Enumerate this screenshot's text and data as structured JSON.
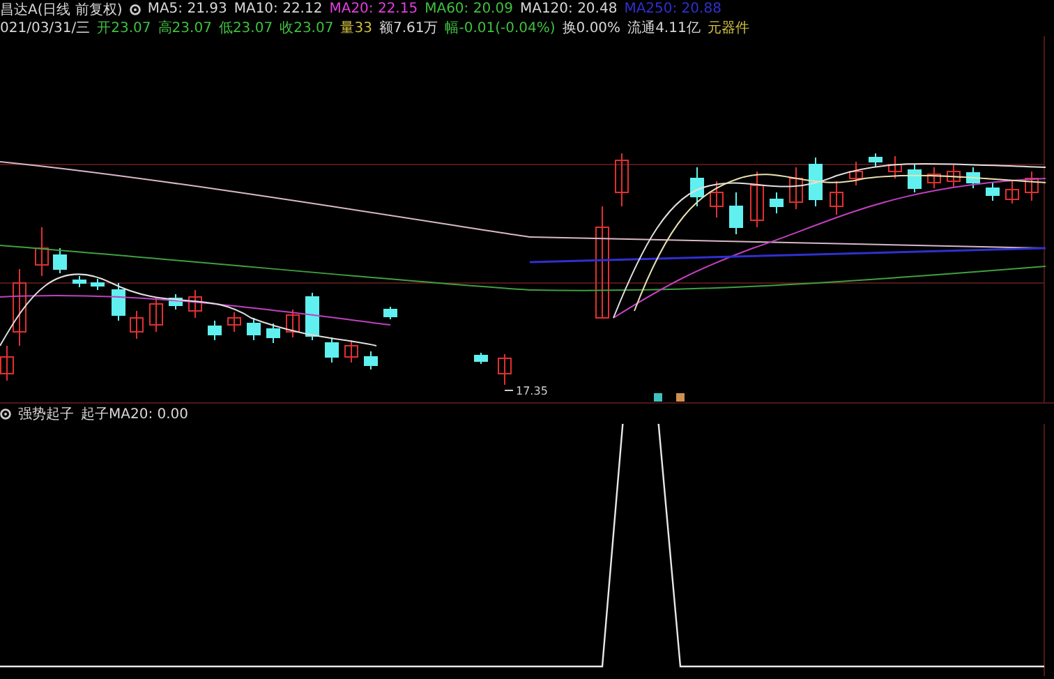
{
  "header": {
    "title": "昌达A(日线 前复权)",
    "indicators": [
      {
        "label": "MA5: 21.93",
        "color": "#d8d8d8"
      },
      {
        "label": "MA10: 22.12",
        "color": "#d8d8d8"
      },
      {
        "label": "MA20: 22.15",
        "color": "#e040e0"
      },
      {
        "label": "MA60: 20.09",
        "color": "#40c040"
      },
      {
        "label": "MA120: 20.48",
        "color": "#d8d8d8"
      },
      {
        "label": "MA250: 20.88",
        "color": "#3030d0"
      }
    ],
    "quote": [
      {
        "text": "021/03/31/三",
        "color": "#d8d8d8"
      },
      {
        "text": "开23.07",
        "color": "#40c040"
      },
      {
        "text": "高23.07",
        "color": "#40c040"
      },
      {
        "text": "低23.07",
        "color": "#40c040"
      },
      {
        "text": "收23.07",
        "color": "#40c040"
      },
      {
        "text": "量33",
        "color": "#d0c040"
      },
      {
        "text": "额7.61万",
        "color": "#d8d8d8"
      },
      {
        "text": "幅-0.01(-0.04%)",
        "color": "#40c040"
      },
      {
        "text": "换0.00%",
        "color": "#d8d8d8"
      },
      {
        "text": "流通4.11亿",
        "color": "#d8d8d8"
      },
      {
        "text": "元器件",
        "color": "#d0c040"
      }
    ]
  },
  "main_chart": {
    "low_label": "17.35"
  },
  "indicator_panel": {
    "name": "强势起子",
    "value": "起子MA20: 0.00"
  }
}
